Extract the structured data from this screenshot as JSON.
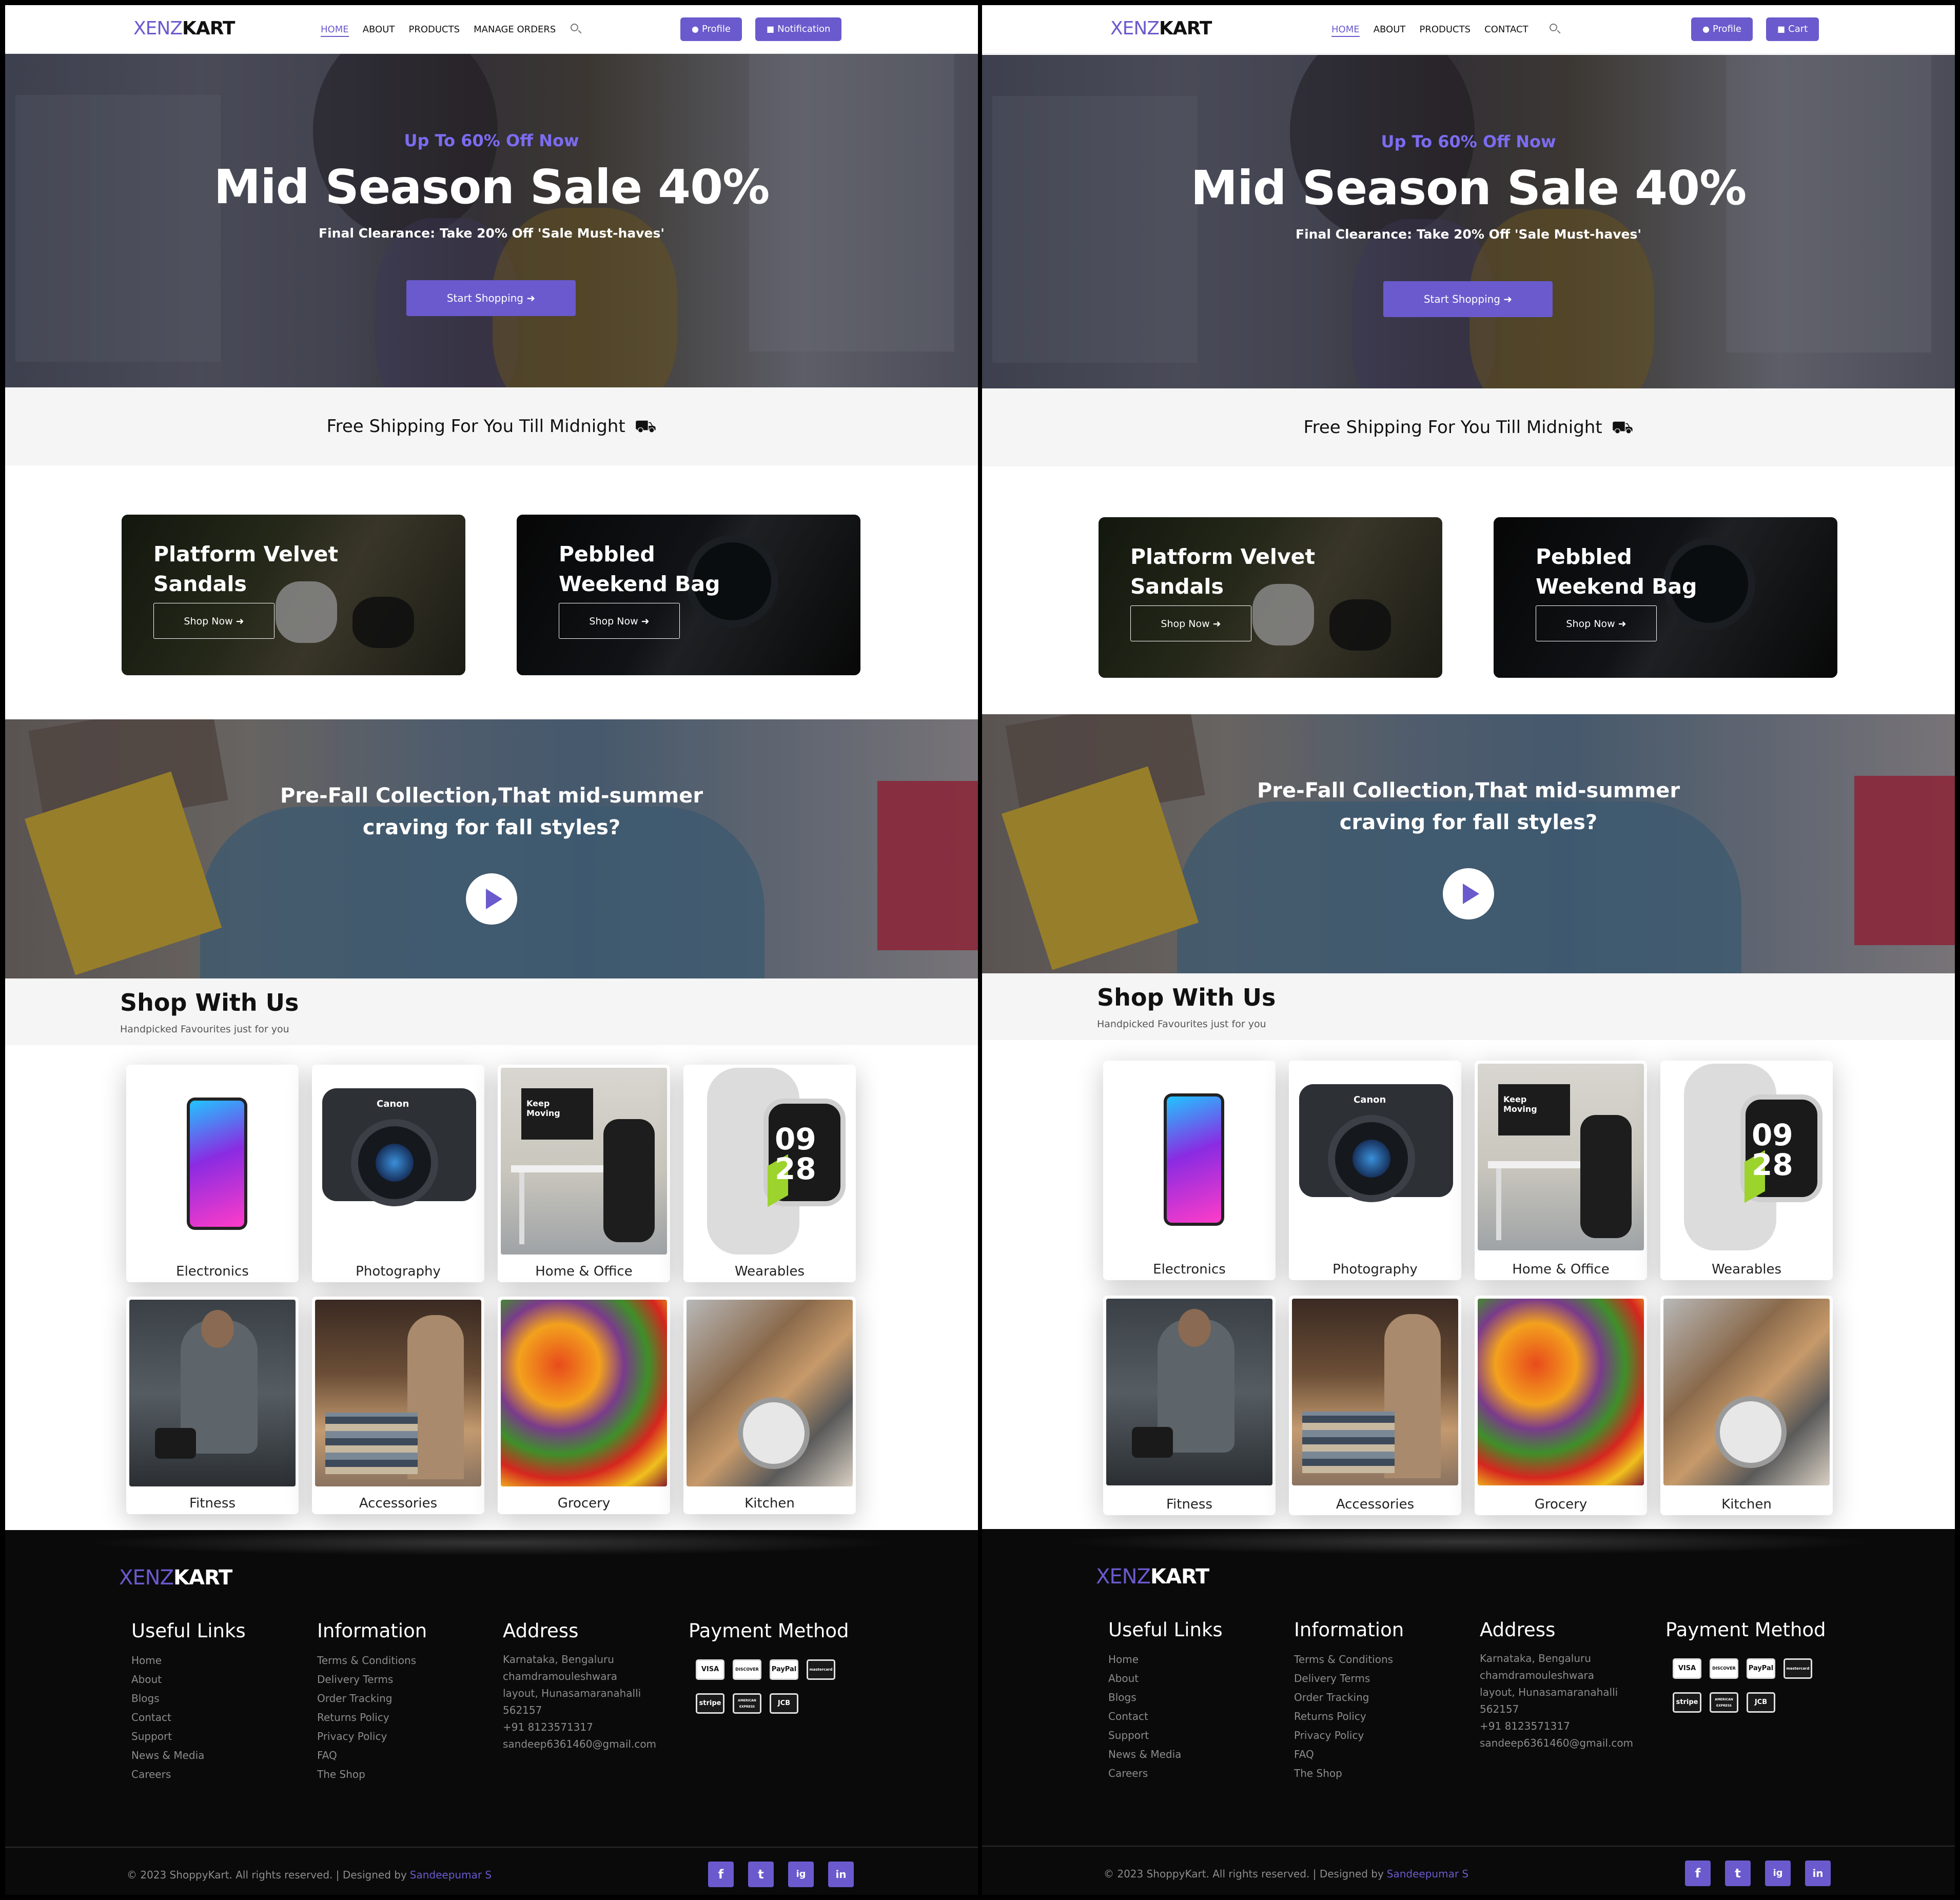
{
  "brand": {
    "part1": "XENZ",
    "part2": "KART",
    "accent": "#6a5acd"
  },
  "left": {
    "nav": [
      "HOME",
      "ABOUT",
      "PRODUCTS",
      "MANAGE ORDERS"
    ],
    "btn1": "Profile",
    "btn2": "Notification"
  },
  "right": {
    "nav": [
      "HOME",
      "ABOUT",
      "PRODUCTS",
      "CONTACT"
    ],
    "btn1": "Profile",
    "btn2": "Cart"
  },
  "hero": {
    "subtitle": "Up To 60% Off Now",
    "title": "Mid Season Sale 40%",
    "description": "Final Clearance: Take 20% Off 'Sale Must-haves'",
    "button": "Start Shopping"
  },
  "shipping": "Free Shipping For You Till Midnight",
  "promos": [
    {
      "title": "Platform Velvet Sandals",
      "button": "Shop Now"
    },
    {
      "title": "Pebbled Weekend Bag",
      "button": "Shop Now"
    }
  ],
  "video": {
    "title": "Pre-Fall Collection,That mid-summer craving for fall styles?"
  },
  "shop": {
    "title": "Shop With Us",
    "subtitle": "Handpicked Favourites just for you",
    "categories": [
      "Electronics",
      "Photography",
      "Home & Office",
      "Wearables",
      "Fitness",
      "Accessories",
      "Grocery",
      "Kitchen"
    ],
    "image_text": {
      "camera": "Canon",
      "sign": "Keep Moving",
      "watch_time": "09\n28"
    }
  },
  "footer": {
    "useful_links": {
      "title": "Useful Links",
      "items": [
        "Home",
        "About",
        "Blogs",
        "Contact",
        "Support",
        "News & Media",
        "Careers"
      ]
    },
    "information": {
      "title": "Information",
      "items": [
        "Terms & Conditions",
        "Delivery Terms",
        "Order Tracking",
        "Returns Policy",
        "Privacy Policy",
        "FAQ",
        "The Shop"
      ]
    },
    "address": {
      "title": "Address",
      "lines": [
        "Karnataka, Bengaluru",
        "chamdramouleshwara",
        "layout, Hunasamaranahalli",
        "562157",
        "+91 8123571317",
        "sandeep6361460@gmail.com"
      ]
    },
    "payment": {
      "title": "Payment Method",
      "cards": [
        "VISA",
        "DISCOVER",
        "PayPal",
        "mastercard",
        "stripe",
        "AMERICAN EXPRESS",
        "JCB"
      ]
    },
    "copyright": "© 2023 ShoppyKart. All rights reserved. | Designed by",
    "designer": "Sandeepumar S",
    "social": [
      "f",
      "t",
      "ig",
      "in"
    ]
  }
}
